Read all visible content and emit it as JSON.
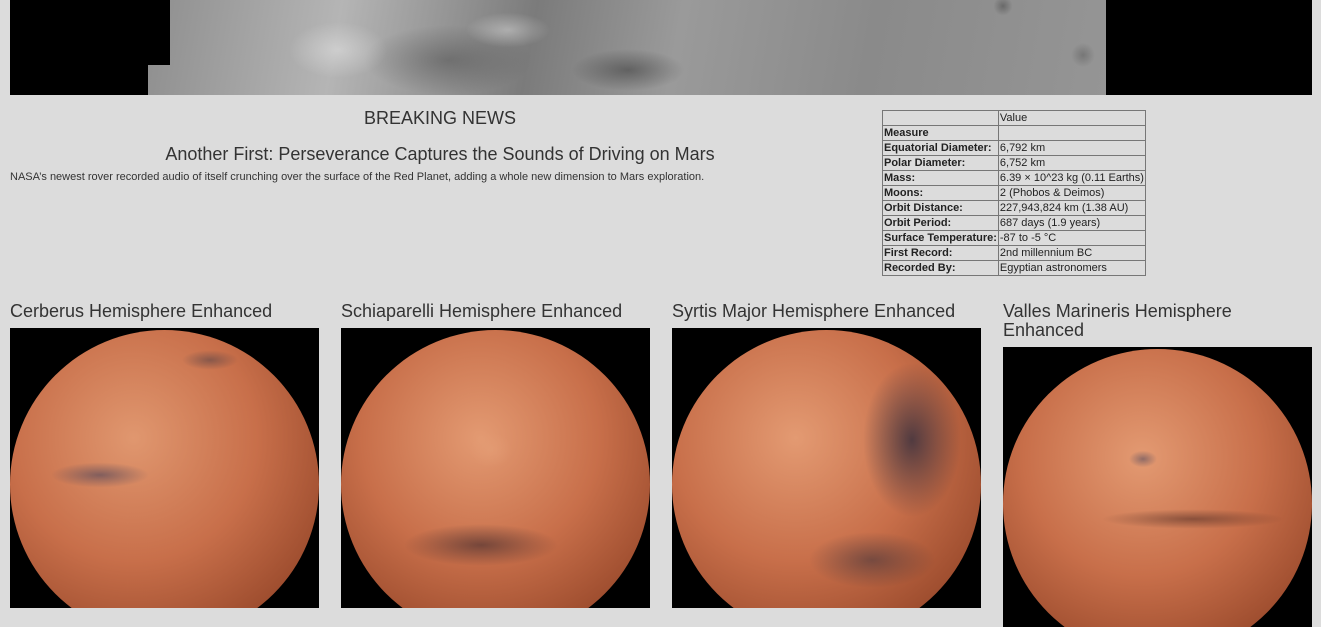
{
  "news": {
    "section_heading": "BREAKING NEWS",
    "title": "Another First: Perseverance Captures the Sounds of Driving on Mars",
    "paragraph": "NASA’s newest rover recorded audio of itself crunching over the surface of the Red Planet, adding a whole new dimension to Mars exploration."
  },
  "facts": {
    "header_label": "",
    "header_value": "Value",
    "subheader": "Measure",
    "rows": [
      {
        "label": "Equatorial Diameter:",
        "value": "6,792 km"
      },
      {
        "label": "Polar Diameter:",
        "value": "6,752 km"
      },
      {
        "label": "Mass:",
        "value": "6.39 × 10^23 kg (0.11 Earths)"
      },
      {
        "label": "Moons:",
        "value": "2 (Phobos & Deimos)"
      },
      {
        "label": "Orbit Distance:",
        "value": "227,943,824 km (1.38 AU)"
      },
      {
        "label": "Orbit Period:",
        "value": "687 days (1.9 years)"
      },
      {
        "label": "Surface Temperature:",
        "value": "-87 to -5 °C"
      },
      {
        "label": "First Record:",
        "value": "2nd millennium BC"
      },
      {
        "label": "Recorded By:",
        "value": "Egyptian astronomers"
      }
    ]
  },
  "hemispheres": [
    {
      "title": "Cerberus Hemisphere Enhanced"
    },
    {
      "title": "Schiaparelli Hemisphere Enhanced"
    },
    {
      "title": "Syrtis Major Hemisphere Enhanced"
    },
    {
      "title": "Valles Marineris Hemisphere Enhanced"
    }
  ]
}
